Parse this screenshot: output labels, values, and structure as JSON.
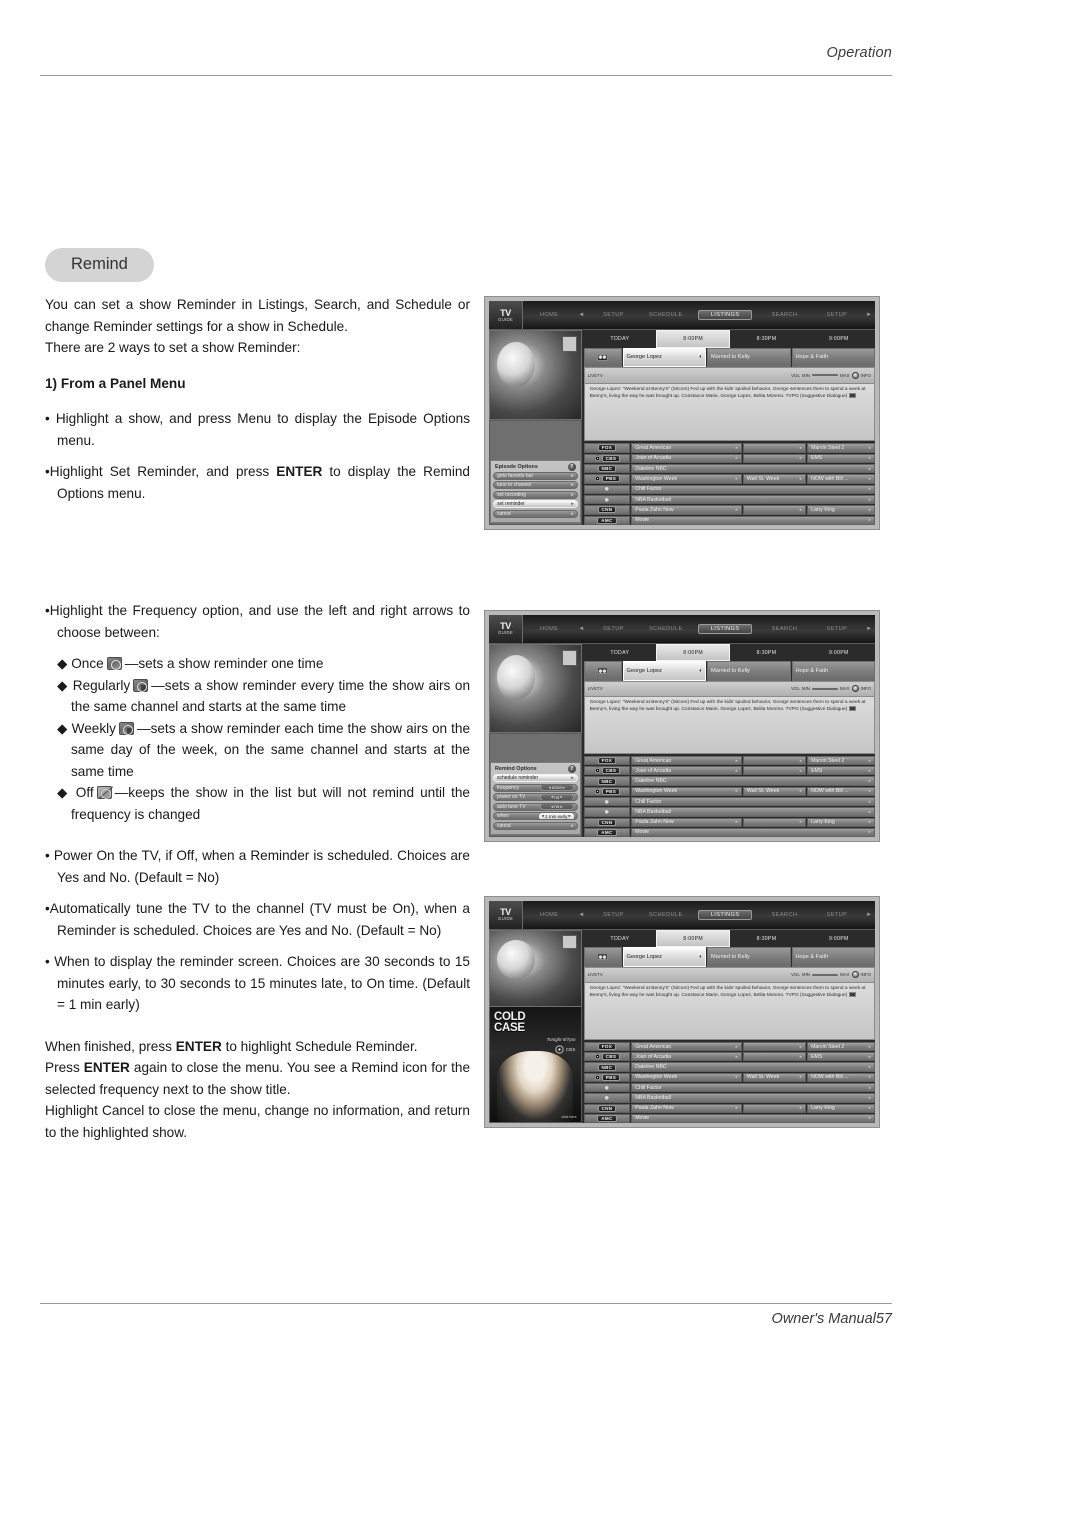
{
  "header": {
    "section": "Operation"
  },
  "footer": {
    "manual": "Owner's Manual",
    "page": "57"
  },
  "pill": {
    "label": "Remind"
  },
  "body": {
    "intro_1": "You can set a show Reminder in Listings, Search, and Schedule or change Reminder settings for a show in Schedule.",
    "intro_2": "There are 2 ways to set a show Reminder:",
    "heading_1": "1) From a Panel Menu",
    "bullet_1": "Highlight a show, and press Menu to display the Episode Options  menu.",
    "bullet_2_a": "Highlight Set Reminder, and press ",
    "bullet_2_b": "ENTER",
    "bullet_2_c": " to display the Remind Options menu.",
    "bullet_3": "Highlight the Frequency option, and use the left and right arrows to choose between:",
    "freq_once_label": "Once",
    "freq_once_text": "—sets a show reminder one time",
    "freq_reg_label": "Regularly",
    "freq_reg_text": "—sets a show reminder every time the show airs on the same channel and starts at the same time",
    "freq_week_label": "Weekly",
    "freq_week_text": "—sets a show reminder each time the show airs on the same day of the week, on the same channel and starts at the same time",
    "freq_off_label": "Off",
    "freq_off_text": "—keeps the show in the list but will not remind until the frequency is changed",
    "bullet_4": "Power On the TV, if Off, when a Reminder is scheduled. Choices are Yes and No. (Default = No)",
    "bullet_5": "Automatically tune the TV to the channel (TV must be On), when a Reminder is scheduled. Choices are Yes and No. (Default = No)",
    "bullet_6": "When to display the reminder screen. Choices are 30 seconds to 15 minutes early, to 30 seconds to 15 minutes late, to On time. (Default = 1 min early)",
    "closing_1_a": "When finished, press ",
    "closing_1_b": "ENTER",
    "closing_1_c": " to highlight Schedule Reminder.",
    "closing_2_a": "Press ",
    "closing_2_b": "ENTER",
    "closing_2_c": " again to close the menu. You see a Remind icon for the selected frequency next to the show title.",
    "closing_3": "Highlight Cancel to close the menu, change no information, and return to the highlighted show."
  },
  "tvguide": {
    "logo_line1": "TV",
    "logo_line2": "GUIDE",
    "nav": [
      {
        "label": "HOME",
        "selected": false
      },
      {
        "label": "SETUP",
        "selected": false
      },
      {
        "label": "SCHEDULE",
        "selected": false
      },
      {
        "label": "LISTINGS",
        "selected": true
      },
      {
        "label": "SEARCH",
        "selected": false
      },
      {
        "label": "SETUP",
        "selected": false
      }
    ],
    "timebar": [
      {
        "label": "TODAY",
        "current": false
      },
      {
        "label": "8:00PM",
        "current": true
      },
      {
        "label": "8:30PM",
        "current": false
      },
      {
        "label": "9:00PM",
        "current": false
      }
    ],
    "programs": [
      {
        "label": "George Lopez",
        "selected": true
      },
      {
        "label": "Married to Kelly",
        "selected": false
      },
      {
        "label": "Hope & Faith",
        "selected": false
      }
    ],
    "infobar_left": "LIVETV",
    "infobar_vol": "VOL",
    "infobar_min": "MIN",
    "infobar_max": "MAX",
    "description": "George Lopez: \"Weekend at Benny's\" (Sitcom) Fed up with the kids' spoiled behavior, George sentences them to spend a week at Benny's, living the way he was brought up. Constance Marie, George Lopez, Belita Moreno. TVPG (Suggestive Dialogue)",
    "grid_rows": [
      {
        "channel": "FOX",
        "eye": false,
        "cells": [
          {
            "title": "Great American",
            "w": "g-w1"
          },
          {
            "title": "",
            "w": "g-w2"
          },
          {
            "title": "Marvin Steel 2",
            "w": "g-w3"
          }
        ]
      },
      {
        "channel": "CBS",
        "eye": true,
        "cells": [
          {
            "title": "Joan of Arcadia",
            "w": "g-w1"
          },
          {
            "title": "",
            "w": "g-w2"
          },
          {
            "title": "EMS",
            "w": "g-w3"
          }
        ]
      },
      {
        "channel": "NBC",
        "eye": false,
        "cells": [
          {
            "title": "Dateline NBC",
            "w": "g-full"
          }
        ]
      },
      {
        "channel": "PBS",
        "eye": true,
        "cells": [
          {
            "title": "Washington Week",
            "w": "g-w1"
          },
          {
            "title": "Wall St. Week",
            "w": "g-w2"
          },
          {
            "title": "NOW with Bill ...",
            "w": "g-w3"
          }
        ]
      },
      {
        "channel": "",
        "eye": false,
        "cells": [
          {
            "title": "Chill Factor",
            "w": "g-full"
          }
        ]
      },
      {
        "channel": "",
        "eye": false,
        "cells": [
          {
            "title": "NBA Basketball",
            "w": "g-full"
          }
        ]
      },
      {
        "channel": "CNN",
        "eye": false,
        "cells": [
          {
            "title": "Paula Zahn Now",
            "w": "g-w1"
          },
          {
            "title": "",
            "w": "g-w2"
          },
          {
            "title": "Larry King",
            "w": "g-w3"
          }
        ]
      },
      {
        "channel": "AMC",
        "eye": false,
        "cells": [
          {
            "title": "Movie",
            "w": "g-full"
          }
        ]
      }
    ],
    "episode_options": {
      "title": "Episode Options",
      "help": "?",
      "items": [
        {
          "label": "goto favorite bar",
          "selected": false
        },
        {
          "label": "tune to channel",
          "selected": false
        },
        {
          "label": "set recording",
          "selected": false
        },
        {
          "label": "set reminder",
          "selected": true
        },
        {
          "label": "cancel",
          "selected": false
        }
      ]
    },
    "remind_options": {
      "title": "Remind Options",
      "help": "?",
      "schedule_label": "schedule reminder",
      "rows": [
        {
          "label": "frequency",
          "value": "once",
          "highlight": false
        },
        {
          "label": "power on TV",
          "value": "no",
          "highlight": false
        },
        {
          "label": "auto tune TV",
          "value": "no",
          "highlight": false
        },
        {
          "label": "when",
          "value": "1 min early",
          "highlight": true
        }
      ],
      "cancel_label": "cancel"
    },
    "ad": {
      "title_line1": "COLD",
      "title_line2": "CASE",
      "tonight": "Tonight 8/7pm",
      "network": "CBS",
      "corner": "click\nhere"
    }
  }
}
